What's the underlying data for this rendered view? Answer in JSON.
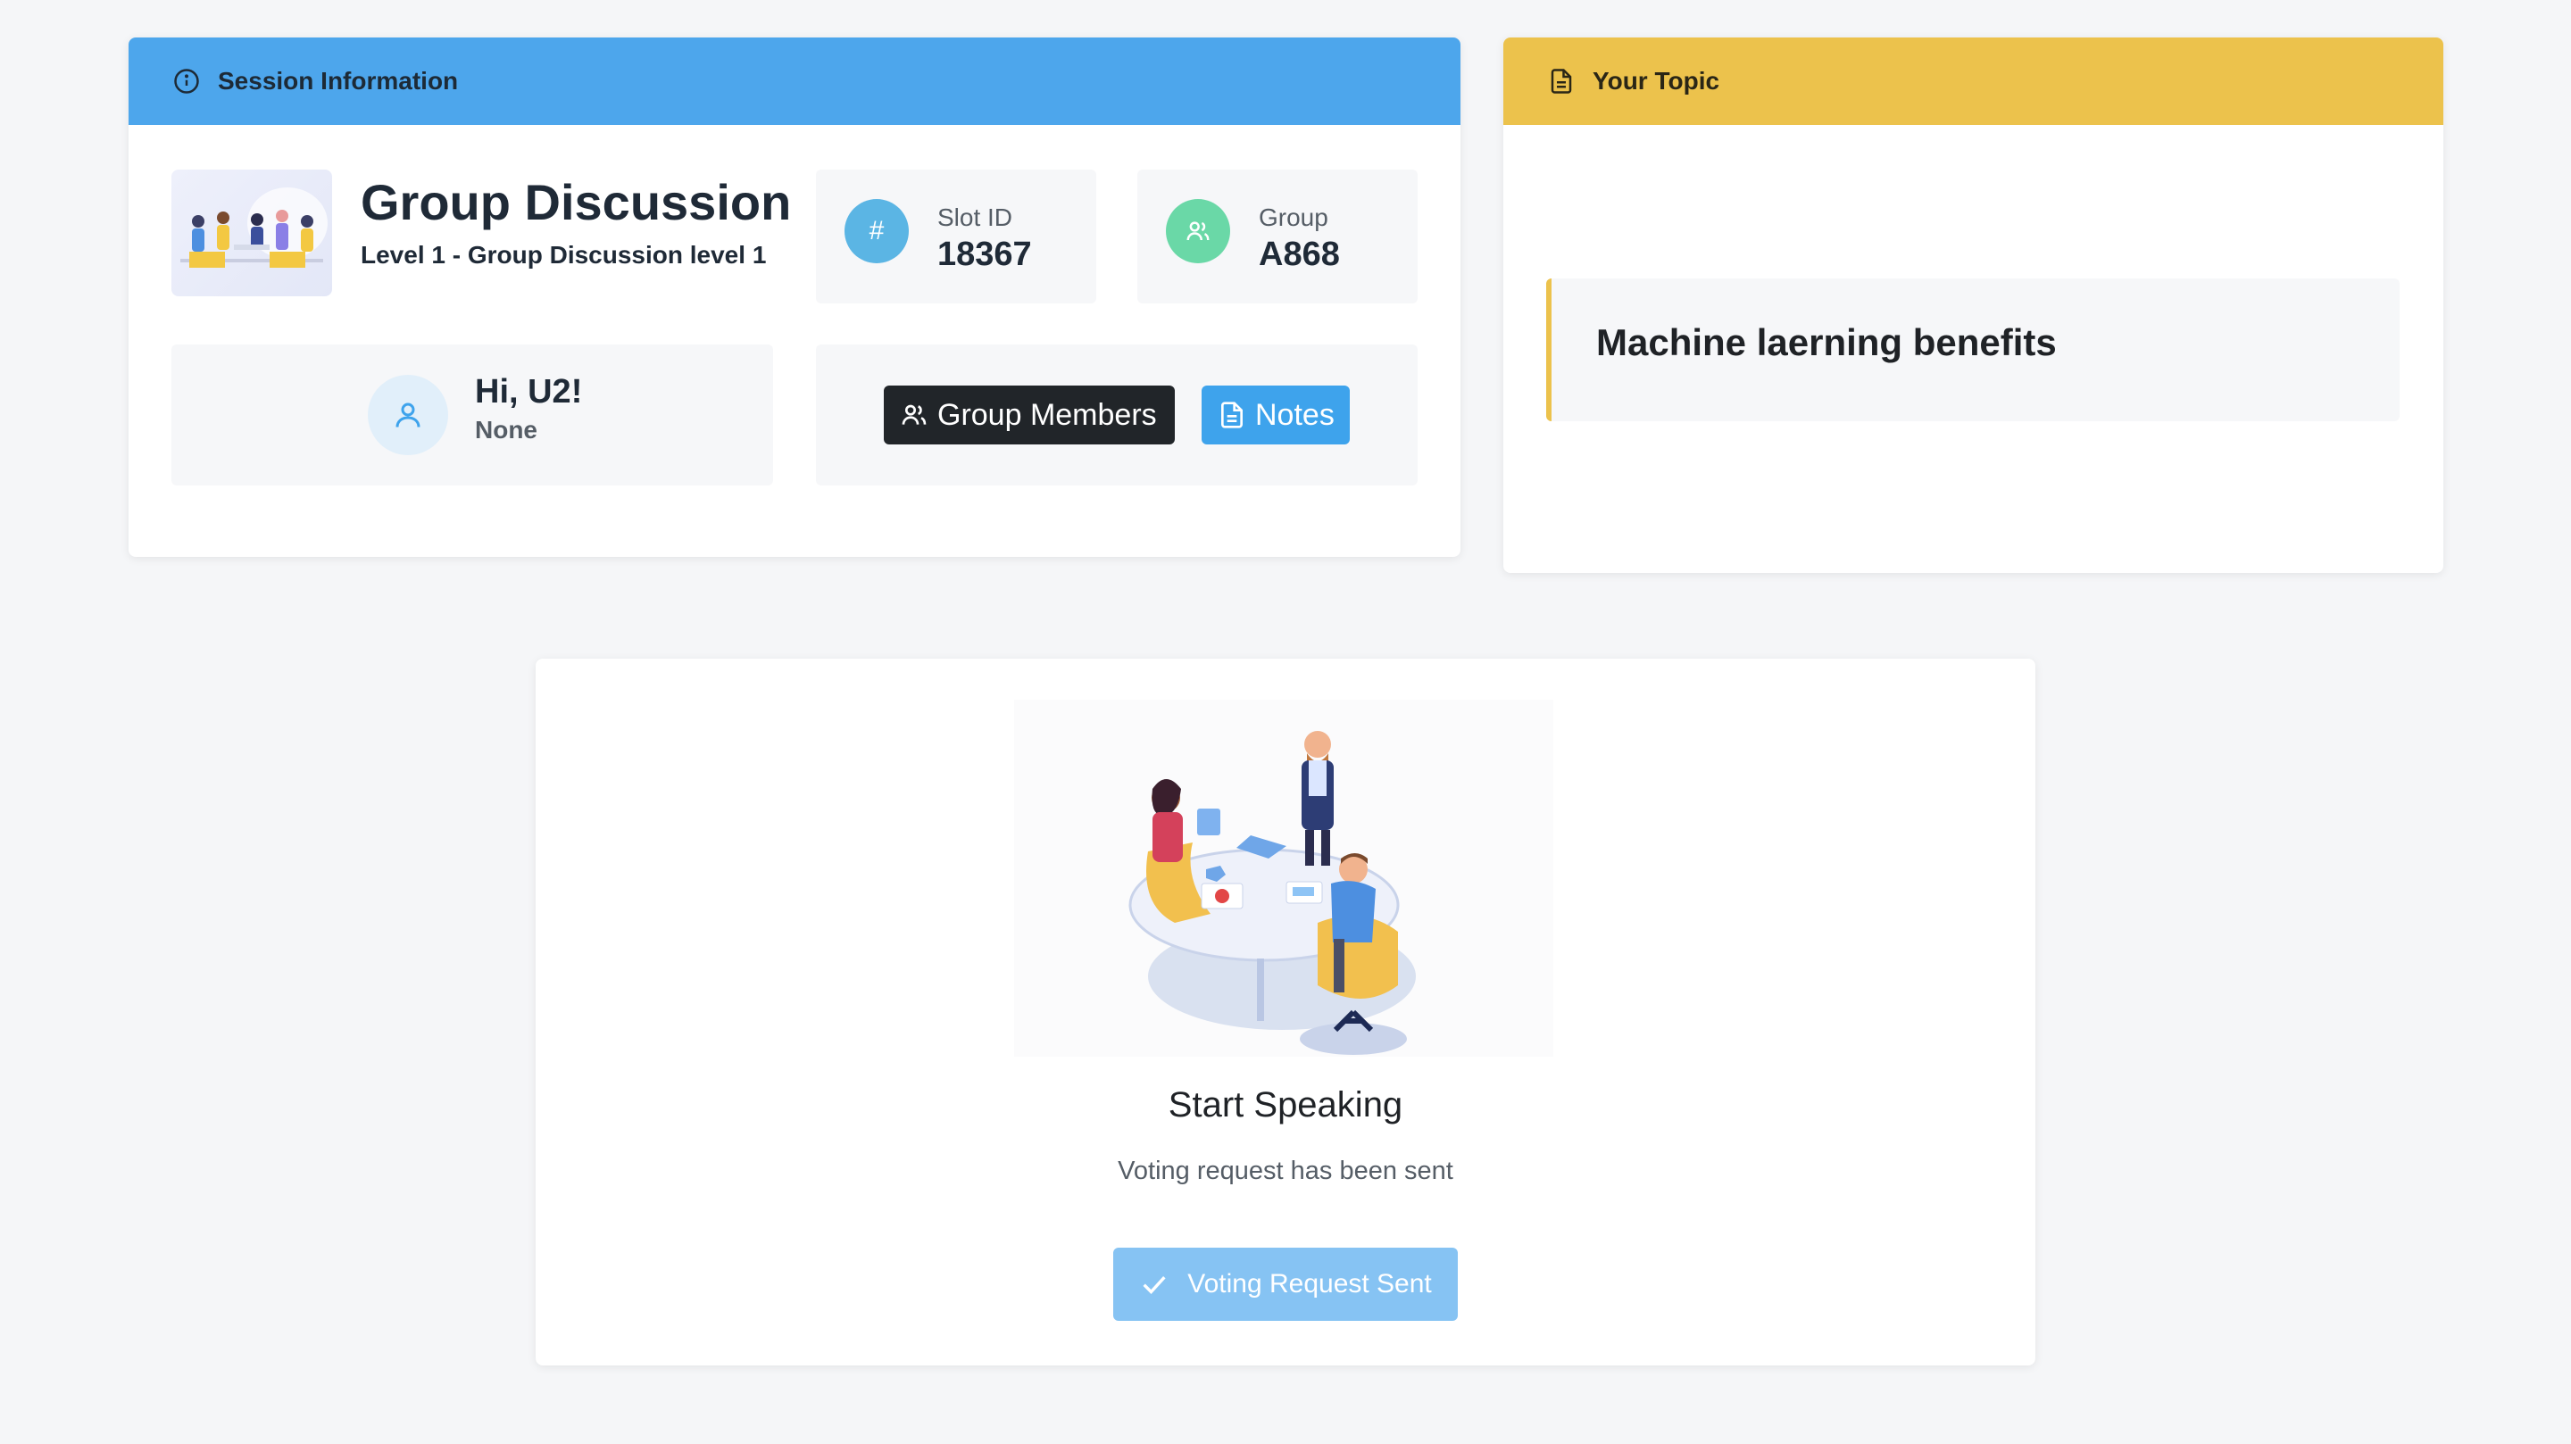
{
  "session": {
    "header": "Session Information",
    "title": "Group Discussion",
    "subtitle": "Level 1 - Group Discussion level 1",
    "slot": {
      "label": "Slot ID",
      "value": "18367",
      "icon_char": "#"
    },
    "group": {
      "label": "Group",
      "value": "A868"
    },
    "user": {
      "greeting": "Hi, U2!",
      "role": "None"
    },
    "buttons": {
      "members": "Group Members",
      "notes": "Notes"
    }
  },
  "topic": {
    "header": "Your Topic",
    "text": "Machine laerning benefits"
  },
  "speak": {
    "title": "Start Speaking",
    "subtitle": "Voting request has been sent",
    "button": "Voting Request Sent"
  },
  "icons": {
    "session_header": "info-circle-icon",
    "topic_header": "document-icon",
    "slot": "hash-icon",
    "group": "users-icon",
    "user": "user-icon",
    "members_button": "users-icon",
    "notes_button": "document-icon",
    "vote_button": "check-icon"
  },
  "colors": {
    "session_header": "#4da6ec",
    "topic_header": "#ecc24c",
    "slot_circle": "#5bb5e4",
    "group_circle": "#6ad8a7",
    "members_button": "#212529",
    "notes_button": "#3ea3ec",
    "vote_button": "#86c3f3"
  }
}
